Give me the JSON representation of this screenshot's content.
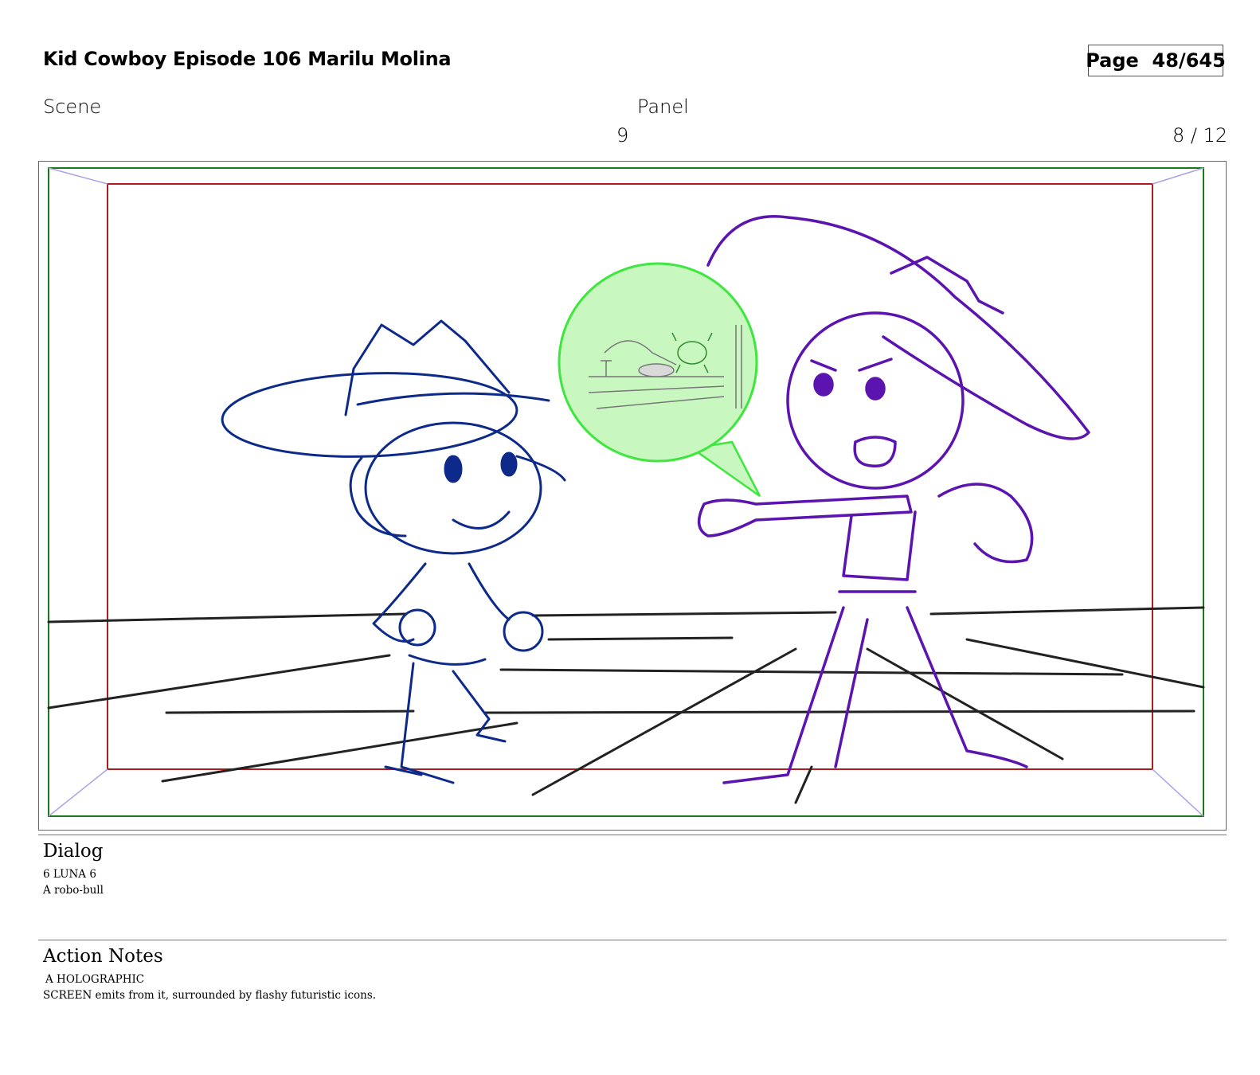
{
  "header": {
    "title": "Kid Cowboy Episode 106 Marilu Molina",
    "page": "Page  48/645"
  },
  "labels": {
    "scene": "Scene",
    "panel": "Panel"
  },
  "values": {
    "scene_number": "9",
    "panel_count": "8 / 12"
  },
  "dialog": {
    "heading": "Dialog",
    "lines": [
      "6 LUNA 6",
      "A robo-bull"
    ]
  },
  "action_notes": {
    "heading": "Action Notes",
    "lines": [
      "A HOLOGRAPHIC",
      "SCREEN emits from it, surrounded by flashy futuristic icons."
    ]
  },
  "colors": {
    "safe_frame": "#1a7a1a",
    "action_safe": "#b01c1c",
    "left_character": "#0d2a8a",
    "right_character": "#5b14b0",
    "hologram_fill": "#a8f59a",
    "hologram_stroke": "#3ee63e"
  }
}
